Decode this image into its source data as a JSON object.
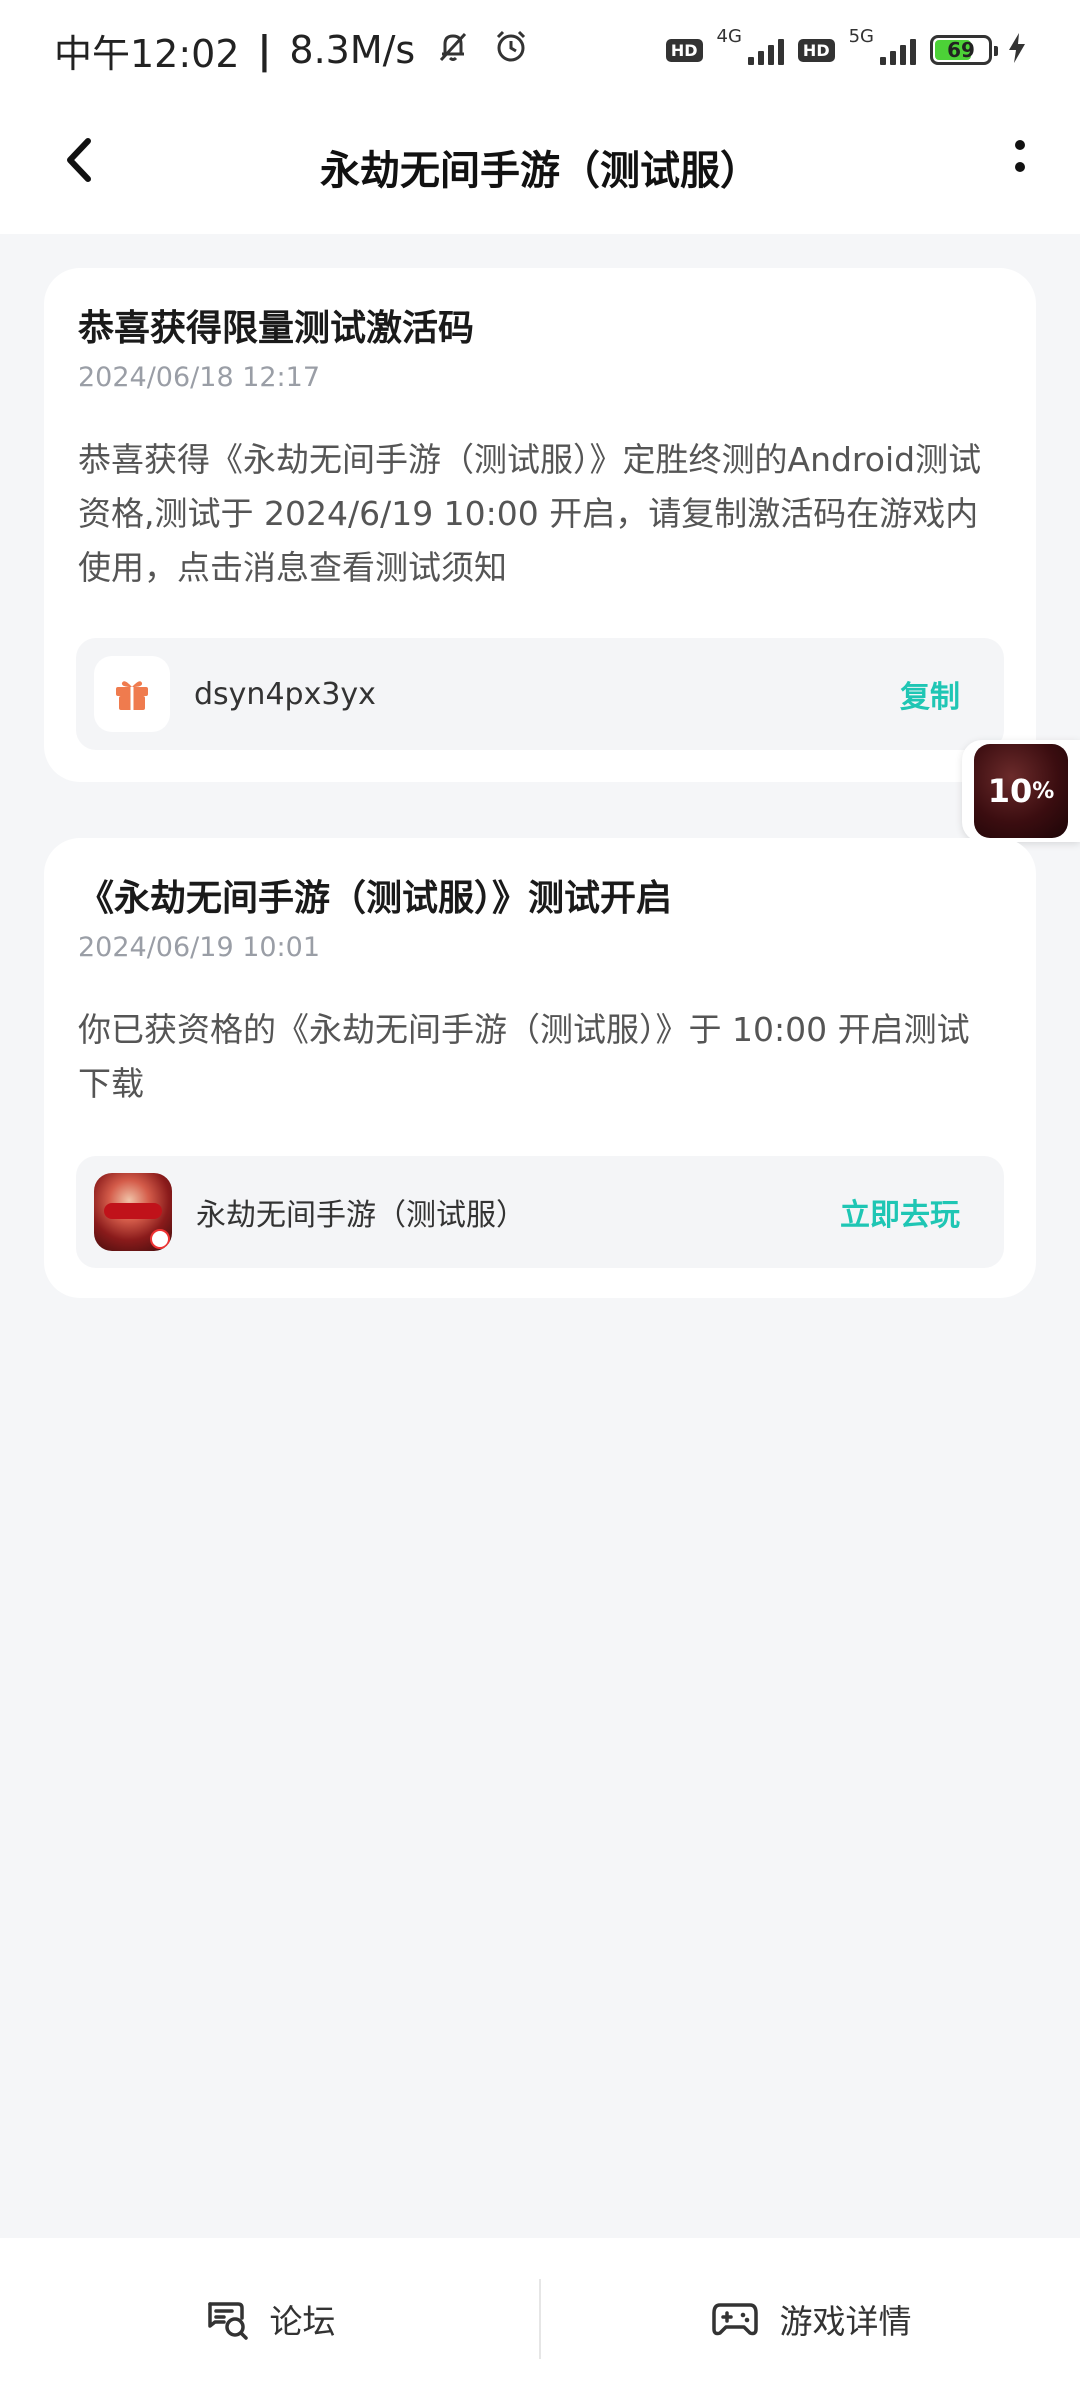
{
  "status_bar": {
    "time": "中午12:02",
    "separator": "|",
    "speed": "8.3M/s",
    "icons": [
      "mute-bell-icon",
      "alarm-icon",
      "hd-icon",
      "signal-4g-icon",
      "hd-icon",
      "signal-5g-icon",
      "battery-icon",
      "charging-icon"
    ],
    "net1": "4G",
    "net2": "5G",
    "hd": "HD",
    "battery": "69",
    "battery_level": 0.69
  },
  "header": {
    "title": "永劫无间手游（测试服）"
  },
  "messages": [
    {
      "title": "恭喜获得限量测试激活码",
      "time": "2024/06/18 12:17",
      "body": "恭喜获得《永劫无间手游（测试服）》定胜终测的Android测试资格,测试于 2024/6/19 10:00 开启，请复制激活码在游戏内使用，点击消息查看测试须知",
      "action": {
        "icon": "gift-icon",
        "text": "dsyn4px3yx",
        "button": "复制"
      }
    },
    {
      "title": "《永劫无间手游（测试服）》测试开启",
      "time": "2024/06/19 10:01",
      "body": "你已获资格的《永劫无间手游（测试服）》于 10:00 开启测试下载",
      "action": {
        "icon": "game-thumbnail",
        "text": "永劫无间手游（测试服）",
        "button": "立即去玩"
      }
    }
  ],
  "float_bubble": {
    "value": "10",
    "unit": "%"
  },
  "bottom_bar": {
    "items": [
      {
        "icon": "forum-icon",
        "label": "论坛"
      },
      {
        "icon": "gamepad-icon",
        "label": "游戏详情"
      }
    ]
  },
  "colors": {
    "accent": "#1fc6b4",
    "gift": "#ef7b4e",
    "background": "#f5f6f8"
  }
}
